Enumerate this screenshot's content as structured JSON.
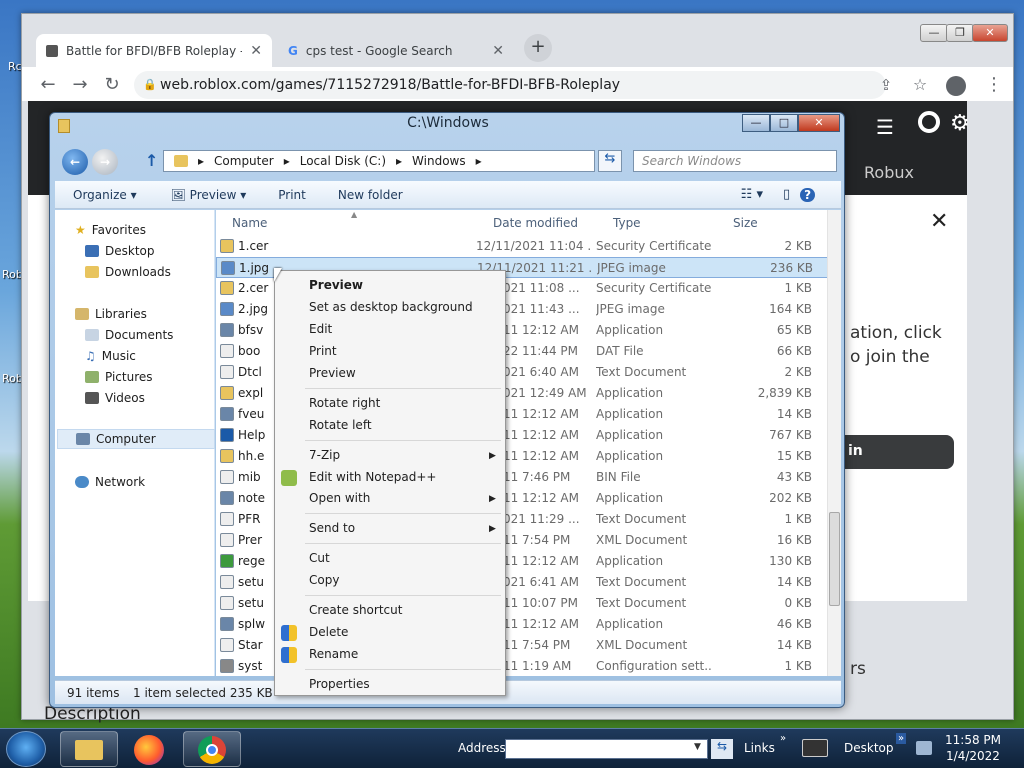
{
  "desktop": {
    "labels": [
      "Rc",
      "Rob",
      "Rob"
    ]
  },
  "browser": {
    "tabs": [
      {
        "title": "Battle for BFDI/BFB Roleplay - Ro",
        "close": "✕"
      },
      {
        "title": "cps test - Google Search",
        "close": "✕"
      }
    ],
    "new_tab": "+",
    "url": "web.roblox.com/games/7115272918/Battle-for-BFDI-BFB-Roleplay",
    "page": {
      "robux": "Robux",
      "close": "✕",
      "text1": "ation, click",
      "text2": "o join the",
      "button_partial": "in",
      "bottom_text": "Description",
      "right_text": "rs"
    },
    "window_buttons": {
      "minimize": "—",
      "maximize": "❐",
      "close": "✕"
    }
  },
  "explorer": {
    "title": "C:\\Windows",
    "breadcrumb": [
      "Computer",
      "Local Disk (C:)",
      "Windows"
    ],
    "search_placeholder": "Search Windows",
    "commands": {
      "organize": "Organize",
      "preview": "Preview",
      "print": "Print",
      "new_folder": "New folder"
    },
    "nav": {
      "favorites": "Favorites",
      "desktop": "Desktop",
      "downloads": "Downloads",
      "libraries": "Libraries",
      "documents": "Documents",
      "music": "Music",
      "pictures": "Pictures",
      "videos": "Videos",
      "computer": "Computer",
      "network": "Network"
    },
    "columns": {
      "name": "Name",
      "date": "Date modified",
      "type": "Type",
      "size": "Size"
    },
    "files": [
      {
        "name": "1.cer",
        "date": "12/11/2021 11:04 ...",
        "type": "Security Certificate",
        "size": "2 KB"
      },
      {
        "name": "1.jpg",
        "date": "12/11/2021 11:21 ...",
        "type": "JPEG image",
        "size": "236 KB"
      },
      {
        "name": "2.cer",
        "date": "11/2021 11:08 ...",
        "type": "Security Certificate",
        "size": "1 KB"
      },
      {
        "name": "2.jpg",
        "date": "11/2021 11:43 ...",
        "type": "JPEG image",
        "size": "164 KB"
      },
      {
        "name": "bfsv",
        "date": "7/2011 12:12 AM",
        "type": "Application",
        "size": "65 KB"
      },
      {
        "name": "boo",
        "date": "4/2022 11:44 PM",
        "type": "DAT File",
        "size": "66 KB"
      },
      {
        "name": "Dtcl",
        "date": "12/2021 6:40 AM",
        "type": "Text Document",
        "size": "2 KB"
      },
      {
        "name": "expl",
        "date": "12/2021 12:49 AM",
        "type": "Application",
        "size": "2,839 KB"
      },
      {
        "name": "fveu",
        "date": "7/2011 12:12 AM",
        "type": "Application",
        "size": "14 KB"
      },
      {
        "name": "Help",
        "date": "7/2011 12:12 AM",
        "type": "Application",
        "size": "767 KB"
      },
      {
        "name": "hh.e",
        "date": "7/2011 12:12 AM",
        "type": "Application",
        "size": "15 KB"
      },
      {
        "name": "mib",
        "date": "5/2011 7:46 PM",
        "type": "BIN File",
        "size": "43 KB"
      },
      {
        "name": "note",
        "date": "7/2011 12:12 AM",
        "type": "Application",
        "size": "202 KB"
      },
      {
        "name": "PFR",
        "date": "11/2021 11:29 ...",
        "type": "Text Document",
        "size": "1 KB"
      },
      {
        "name": "Prer",
        "date": "5/2011 7:54 PM",
        "type": "XML Document",
        "size": "16 KB"
      },
      {
        "name": "rege",
        "date": "7/2011 12:12 AM",
        "type": "Application",
        "size": "130 KB"
      },
      {
        "name": "setu",
        "date": "12/2021 6:41 AM",
        "type": "Text Document",
        "size": "14 KB"
      },
      {
        "name": "setu",
        "date": "0/2011 10:07 PM",
        "type": "Text Document",
        "size": "0 KB"
      },
      {
        "name": "splw",
        "date": "7/2011 12:12 AM",
        "type": "Application",
        "size": "46 KB"
      },
      {
        "name": "Star",
        "date": "5/2011 7:54 PM",
        "type": "XML Document",
        "size": "14 KB"
      },
      {
        "name": "syst",
        "date": "7/2011 1:19 AM",
        "type": "Configuration sett...",
        "size": "1 KB"
      }
    ],
    "status": {
      "items": "91 items",
      "selected": "1 item selected  235 KB"
    }
  },
  "context_menu": {
    "items": [
      {
        "label": "Preview",
        "bold": true
      },
      {
        "label": "Set as desktop background"
      },
      {
        "label": "Edit"
      },
      {
        "label": "Print"
      },
      {
        "label": "Preview"
      },
      {
        "label": "Rotate right"
      },
      {
        "label": "Rotate left"
      },
      {
        "label": "7-Zip"
      },
      {
        "label": "Edit with Notepad++"
      },
      {
        "label": "Open with"
      },
      {
        "label": "Send to"
      },
      {
        "label": "Cut"
      },
      {
        "label": "Copy"
      },
      {
        "label": "Create shortcut"
      },
      {
        "label": "Delete"
      },
      {
        "label": "Rename"
      },
      {
        "label": "Properties"
      }
    ]
  },
  "taskbar": {
    "address_label": "Address",
    "links": "Links",
    "desktop": "Desktop",
    "time": "11:58 PM",
    "date": "1/4/2022"
  }
}
